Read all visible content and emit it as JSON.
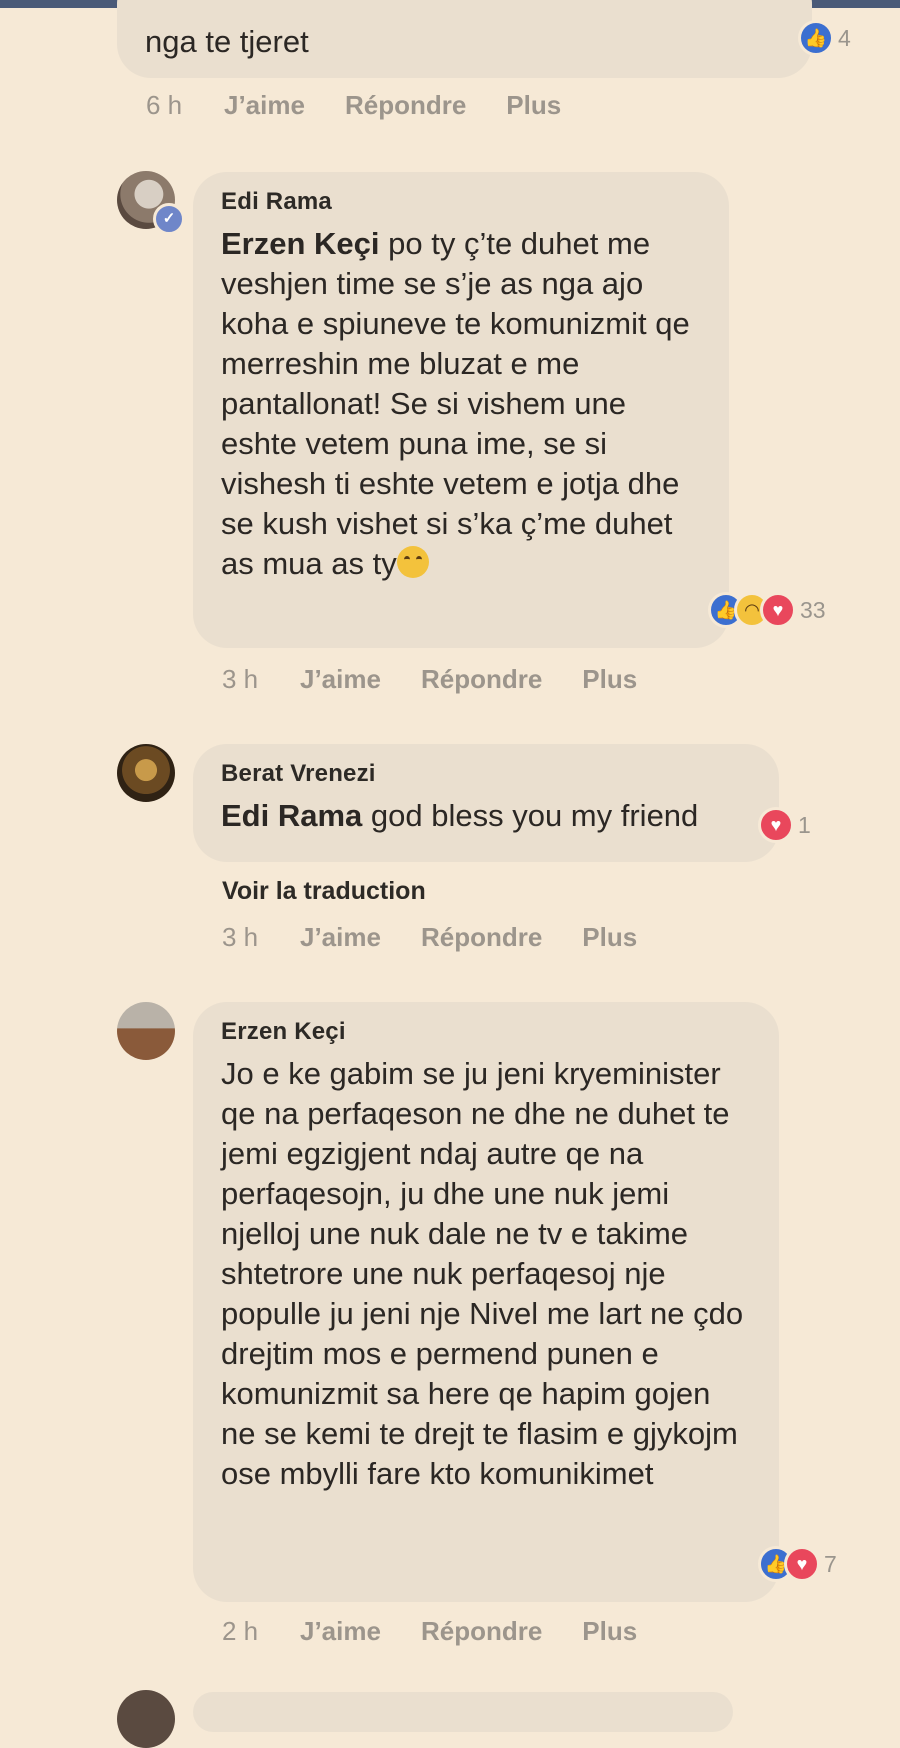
{
  "comments": [
    {
      "author": "",
      "text": "nga te tjeret",
      "reaction_count": "4",
      "time": "6 h"
    },
    {
      "author": "Edi Rama",
      "mention": "Erzen Keçi",
      "text": " po ty ç’te duhet me veshjen time se s’je as nga ajo koha e spiuneve te komunizmit qe merreshin me bluzat e me pantallonat! Se si vishem une eshte vetem puna ime, se si vishesh ti eshte vetem e jotja dhe se kush vishet si s’ka ç’me duhet as mua as ty",
      "reaction_count": "33",
      "time": "3 h"
    },
    {
      "author": "Berat Vrenezi",
      "mention": "Edi Rama",
      "text": " god bless you my friend",
      "reaction_count": "1",
      "see_translation": "Voir la traduction",
      "time": "3 h"
    },
    {
      "author": "Erzen Keçi",
      "text": "Jo e ke gabim se ju jeni kryeminister qe na perfaqeson ne dhe ne duhet te jemi egzigjent ndaj autre qe na perfaqesojn, ju dhe une nuk jemi njelloj une nuk dale ne tv e takime shtetrore une nuk perfaqesoj nje populle ju jeni nje Nivel me lart ne çdo drejtim mos e permend punen e komunizmit sa here qe hapim gojen ne se kemi te drejt te flasim e gjykojm ose mbylli fare kto komunikimet",
      "reaction_count": "7",
      "time": "2 h"
    }
  ],
  "actions": {
    "like": "J’aime",
    "reply": "Répondre",
    "more": "Plus"
  },
  "icons": [
    "like-reaction-icon",
    "haha-reaction-icon",
    "love-reaction-icon",
    "verified-badge-icon"
  ],
  "colors": {
    "background": "#f6e9d6",
    "bubble": "#eadfcf",
    "like": "#3c6fd0",
    "love": "#e9475c",
    "haha": "#f3c23c"
  }
}
